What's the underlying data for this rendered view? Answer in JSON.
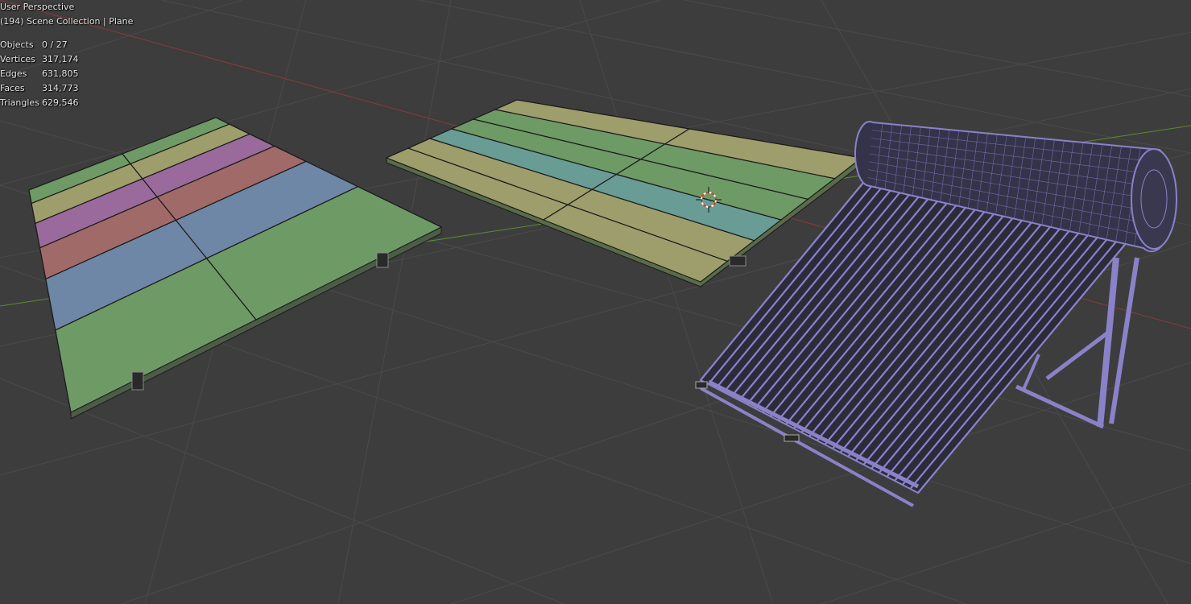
{
  "viewport": {
    "view_name": "User Perspective",
    "collection_line": "(194) Scene Collection | Plane",
    "stats": [
      {
        "label": "Objects",
        "value": "0 / 27"
      },
      {
        "label": "Vertices",
        "value": "317,174"
      },
      {
        "label": "Edges",
        "value": "631,805"
      },
      {
        "label": "Faces",
        "value": "314,773"
      },
      {
        "label": "Triangles",
        "value": "629,546"
      }
    ]
  },
  "colors": {
    "background": "#3d3d3d",
    "grid": "#4a4a4a",
    "x_axis": "#8b3a3a",
    "y_axis": "#5d8a2e",
    "panel_green": "#6e9a66",
    "panel_blue": "#6f87a6",
    "panel_red": "#a06a68",
    "panel_purple": "#9a6a9c",
    "panel_yellow": "#9e9e6c",
    "panel_teal": "#6a9c96",
    "heater_wire": "#8a82c8",
    "outline": "#1a1a1a",
    "cursor": "#d04020"
  },
  "objects": [
    {
      "name": "solar-panel-array-left",
      "icon": "mesh-object"
    },
    {
      "name": "solar-panel-array-center",
      "icon": "mesh-object"
    },
    {
      "name": "solar-water-heater",
      "icon": "mesh-object"
    },
    {
      "name": "3d-cursor",
      "icon": "crosshair-icon"
    }
  ]
}
